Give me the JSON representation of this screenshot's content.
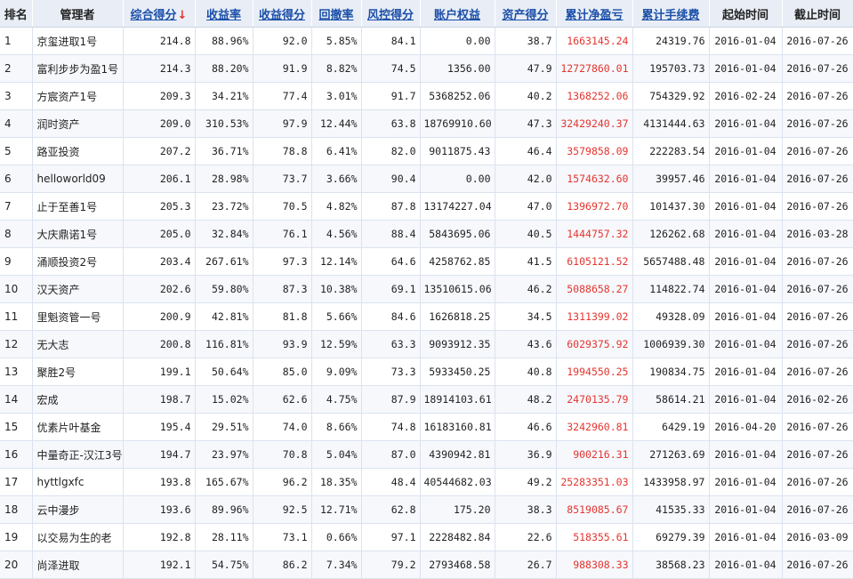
{
  "headers": [
    "排名",
    "管理者",
    "综合得分",
    "收益率",
    "收益得分",
    "回撤率",
    "风控得分",
    "账户权益",
    "资产得分",
    "累计净盈亏",
    "累计手续费",
    "起始时间",
    "截止时间"
  ],
  "sort_arrow": "↓",
  "rows": [
    {
      "rank": "1",
      "name": "京玺进取1号",
      "score": "214.8",
      "return_rate": "88.96%",
      "return_score": "92.0",
      "drawdown": "5.85%",
      "risk_score": "84.1",
      "equity": "0.00",
      "asset_score": "38.7",
      "net_pnl": "1663145.24",
      "fees": "24319.76",
      "start": "2016-01-04",
      "end": "2016-07-26"
    },
    {
      "rank": "2",
      "name": "富利步步为盈1号",
      "score": "214.3",
      "return_rate": "88.20%",
      "return_score": "91.9",
      "drawdown": "8.82%",
      "risk_score": "74.5",
      "equity": "1356.00",
      "asset_score": "47.9",
      "net_pnl": "12727860.01",
      "fees": "195703.73",
      "start": "2016-01-04",
      "end": "2016-07-26"
    },
    {
      "rank": "3",
      "name": "方宸资产1号",
      "score": "209.3",
      "return_rate": "34.21%",
      "return_score": "77.4",
      "drawdown": "3.01%",
      "risk_score": "91.7",
      "equity": "5368252.06",
      "asset_score": "40.2",
      "net_pnl": "1368252.06",
      "fees": "754329.92",
      "start": "2016-02-24",
      "end": "2016-07-26"
    },
    {
      "rank": "4",
      "name": "润时资产",
      "score": "209.0",
      "return_rate": "310.53%",
      "return_score": "97.9",
      "drawdown": "12.44%",
      "risk_score": "63.8",
      "equity": "18769910.60",
      "asset_score": "47.3",
      "net_pnl": "32429240.37",
      "fees": "4131444.63",
      "start": "2016-01-04",
      "end": "2016-07-26"
    },
    {
      "rank": "5",
      "name": "路亚投资",
      "score": "207.2",
      "return_rate": "36.71%",
      "return_score": "78.8",
      "drawdown": "6.41%",
      "risk_score": "82.0",
      "equity": "9011875.43",
      "asset_score": "46.4",
      "net_pnl": "3579858.09",
      "fees": "222283.54",
      "start": "2016-01-04",
      "end": "2016-07-26"
    },
    {
      "rank": "6",
      "name": "helloworld09",
      "score": "206.1",
      "return_rate": "28.98%",
      "return_score": "73.7",
      "drawdown": "3.66%",
      "risk_score": "90.4",
      "equity": "0.00",
      "asset_score": "42.0",
      "net_pnl": "1574632.60",
      "fees": "39957.46",
      "start": "2016-01-04",
      "end": "2016-07-26"
    },
    {
      "rank": "7",
      "name": "止于至善1号",
      "score": "205.3",
      "return_rate": "23.72%",
      "return_score": "70.5",
      "drawdown": "4.82%",
      "risk_score": "87.8",
      "equity": "13174227.04",
      "asset_score": "47.0",
      "net_pnl": "1396972.70",
      "fees": "101437.30",
      "start": "2016-01-04",
      "end": "2016-07-26"
    },
    {
      "rank": "8",
      "name": "大庆鼎诺1号",
      "score": "205.0",
      "return_rate": "32.84%",
      "return_score": "76.1",
      "drawdown": "4.56%",
      "risk_score": "88.4",
      "equity": "5843695.06",
      "asset_score": "40.5",
      "net_pnl": "1444757.32",
      "fees": "126262.68",
      "start": "2016-01-04",
      "end": "2016-03-28"
    },
    {
      "rank": "9",
      "name": "涌顺投资2号",
      "score": "203.4",
      "return_rate": "267.61%",
      "return_score": "97.3",
      "drawdown": "12.14%",
      "risk_score": "64.6",
      "equity": "4258762.85",
      "asset_score": "41.5",
      "net_pnl": "6105121.52",
      "fees": "5657488.48",
      "start": "2016-01-04",
      "end": "2016-07-26"
    },
    {
      "rank": "10",
      "name": "汉天资产",
      "score": "202.6",
      "return_rate": "59.80%",
      "return_score": "87.3",
      "drawdown": "10.38%",
      "risk_score": "69.1",
      "equity": "13510615.06",
      "asset_score": "46.2",
      "net_pnl": "5088658.27",
      "fees": "114822.74",
      "start": "2016-01-04",
      "end": "2016-07-26"
    },
    {
      "rank": "11",
      "name": "里魁资管一号",
      "score": "200.9",
      "return_rate": "42.81%",
      "return_score": "81.8",
      "drawdown": "5.66%",
      "risk_score": "84.6",
      "equity": "1626818.25",
      "asset_score": "34.5",
      "net_pnl": "1311399.02",
      "fees": "49328.09",
      "start": "2016-01-04",
      "end": "2016-07-26"
    },
    {
      "rank": "12",
      "name": "无大志",
      "score": "200.8",
      "return_rate": "116.81%",
      "return_score": "93.9",
      "drawdown": "12.59%",
      "risk_score": "63.3",
      "equity": "9093912.35",
      "asset_score": "43.6",
      "net_pnl": "6029375.92",
      "fees": "1006939.30",
      "start": "2016-01-04",
      "end": "2016-07-26"
    },
    {
      "rank": "13",
      "name": "聚胜2号",
      "score": "199.1",
      "return_rate": "50.64%",
      "return_score": "85.0",
      "drawdown": "9.09%",
      "risk_score": "73.3",
      "equity": "5933450.25",
      "asset_score": "40.8",
      "net_pnl": "1994550.25",
      "fees": "190834.75",
      "start": "2016-01-04",
      "end": "2016-07-26"
    },
    {
      "rank": "14",
      "name": "宏成",
      "score": "198.7",
      "return_rate": "15.02%",
      "return_score": "62.6",
      "drawdown": "4.75%",
      "risk_score": "87.9",
      "equity": "18914103.61",
      "asset_score": "48.2",
      "net_pnl": "2470135.79",
      "fees": "58614.21",
      "start": "2016-01-04",
      "end": "2016-02-26"
    },
    {
      "rank": "15",
      "name": "优素片叶基金",
      "score": "195.4",
      "return_rate": "29.51%",
      "return_score": "74.0",
      "drawdown": "8.66%",
      "risk_score": "74.8",
      "equity": "16183160.81",
      "asset_score": "46.6",
      "net_pnl": "3242960.81",
      "fees": "6429.19",
      "start": "2016-04-20",
      "end": "2016-07-26"
    },
    {
      "rank": "16",
      "name": "中量奇正-汉江3号",
      "score": "194.7",
      "return_rate": "23.97%",
      "return_score": "70.8",
      "drawdown": "5.04%",
      "risk_score": "87.0",
      "equity": "4390942.81",
      "asset_score": "36.9",
      "net_pnl": "900216.31",
      "fees": "271263.69",
      "start": "2016-01-04",
      "end": "2016-07-26"
    },
    {
      "rank": "17",
      "name": "hyttlgxfc",
      "score": "193.8",
      "return_rate": "165.67%",
      "return_score": "96.2",
      "drawdown": "18.35%",
      "risk_score": "48.4",
      "equity": "40544682.03",
      "asset_score": "49.2",
      "net_pnl": "25283351.03",
      "fees": "1433958.97",
      "start": "2016-01-04",
      "end": "2016-07-26"
    },
    {
      "rank": "18",
      "name": "云中漫步",
      "score": "193.6",
      "return_rate": "89.96%",
      "return_score": "92.5",
      "drawdown": "12.71%",
      "risk_score": "62.8",
      "equity": "175.20",
      "asset_score": "38.3",
      "net_pnl": "8519085.67",
      "fees": "41535.33",
      "start": "2016-01-04",
      "end": "2016-07-26"
    },
    {
      "rank": "19",
      "name": "以交易为生的老",
      "score": "192.8",
      "return_rate": "28.11%",
      "return_score": "73.1",
      "drawdown": "0.66%",
      "risk_score": "97.1",
      "equity": "2228482.84",
      "asset_score": "22.6",
      "net_pnl": "518355.61",
      "fees": "69279.39",
      "start": "2016-01-04",
      "end": "2016-03-09"
    },
    {
      "rank": "20",
      "name": "尚泽进取",
      "score": "192.1",
      "return_rate": "54.75%",
      "return_score": "86.2",
      "drawdown": "7.34%",
      "risk_score": "79.2",
      "equity": "2793468.58",
      "asset_score": "26.7",
      "net_pnl": "988308.33",
      "fees": "38568.23",
      "start": "2016-01-04",
      "end": "2016-07-26"
    }
  ]
}
